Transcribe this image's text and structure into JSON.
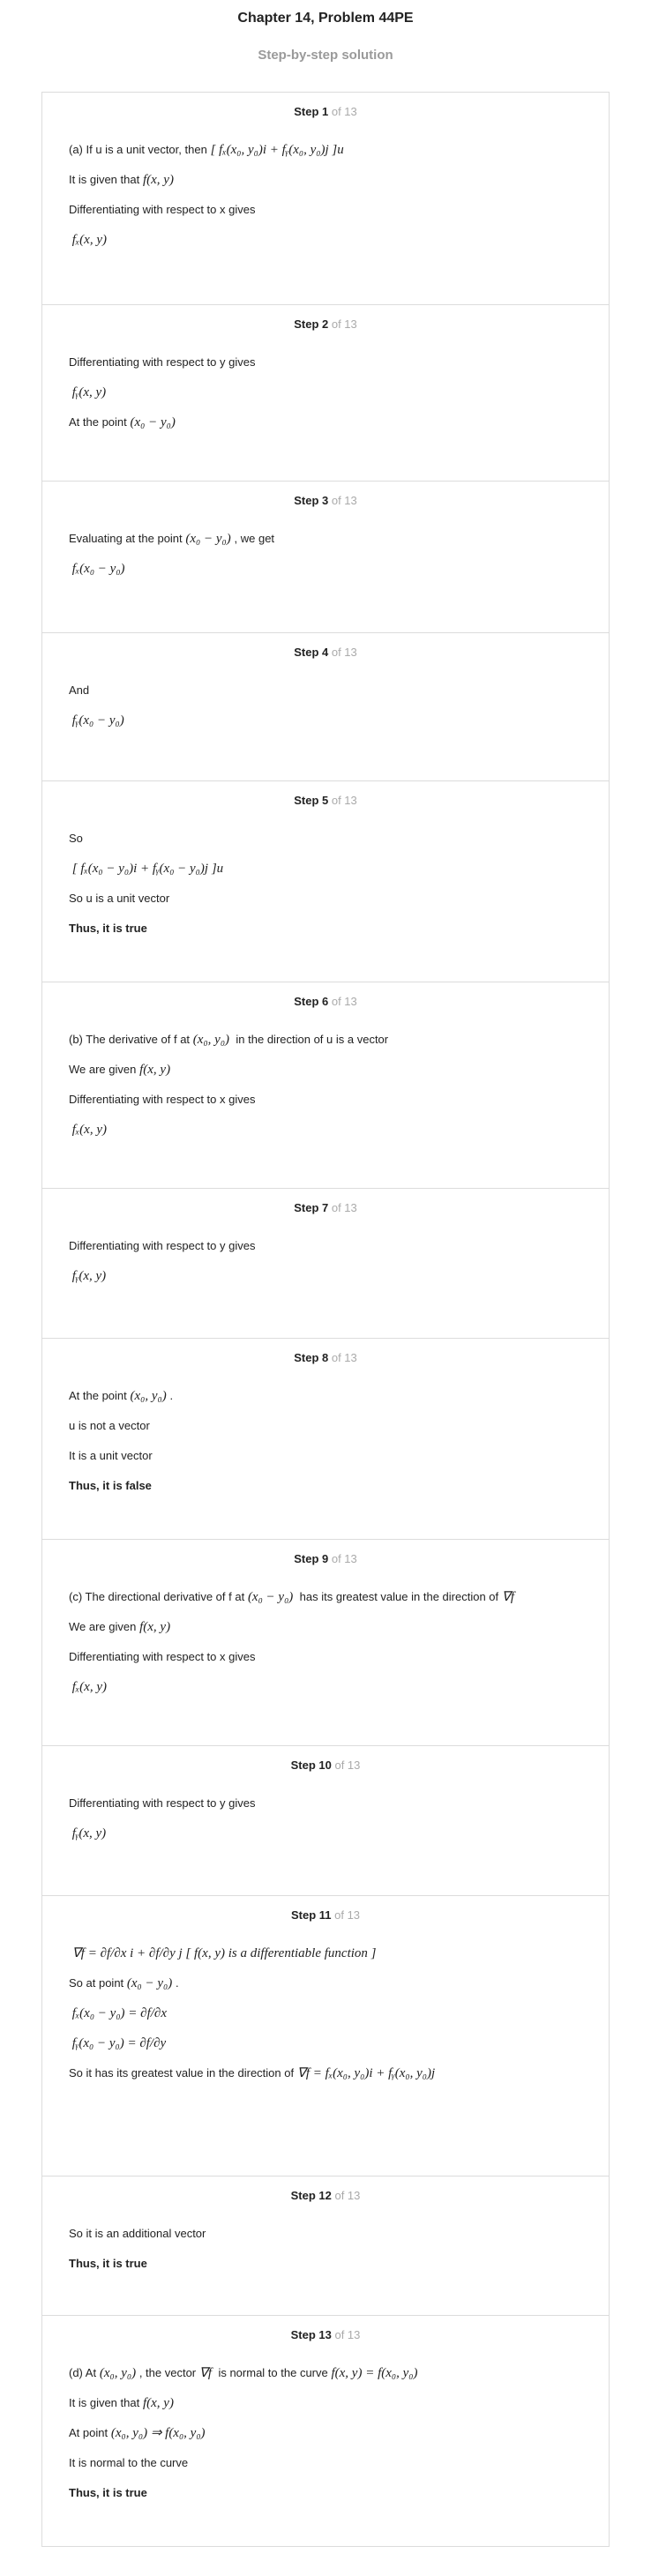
{
  "header": {
    "title": "Chapter 14, Problem 44PE",
    "subtitle": "Step-by-step solution"
  },
  "step_of": "of 13",
  "steps": [
    {
      "label": "Step 1",
      "lines": [
        {
          "t": "(a) If u is a unit vector, then",
          "m": "[ fₓ(x₀, y₀)i + fᵧ(x₀, y₀)j ]u"
        },
        {
          "t": "It is given that",
          "m": "f(x, y)"
        },
        {
          "t": "Differentiating with respect to x gives",
          "m": ""
        },
        {
          "t": "",
          "m": "fₓ(x, y)"
        }
      ]
    },
    {
      "label": "Step 2",
      "lines": [
        {
          "t": "Differentiating with respect to y gives",
          "m": ""
        },
        {
          "t": "",
          "m": "fᵧ(x, y)"
        },
        {
          "t": "At the point",
          "m": "(x₀ − y₀)"
        }
      ]
    },
    {
      "label": "Step 3",
      "lines": [
        {
          "t": "Evaluating at the point",
          "m": "(x₀ − y₀)",
          "t2": ", we get"
        },
        {
          "t": "",
          "m": "fₓ(x₀ − y₀)"
        }
      ]
    },
    {
      "label": "Step 4",
      "lines": [
        {
          "t": "And",
          "m": ""
        },
        {
          "t": "",
          "m": "fᵧ(x₀ − y₀)"
        }
      ]
    },
    {
      "label": "Step 5",
      "lines": [
        {
          "t": "So",
          "m": ""
        },
        {
          "t": "",
          "m": "[ fₓ(x₀ − y₀)i + fᵧ(x₀ − y₀)j ]u"
        },
        {
          "t": "So u is a unit vector",
          "m": ""
        },
        {
          "t": "Thus, it is true",
          "m": "",
          "bold": true
        }
      ]
    },
    {
      "label": "Step 6",
      "lines": [
        {
          "t": "(b) The derivative of f at",
          "m": "(x₀, y₀)",
          "t2": " in the direction of u is a vector"
        },
        {
          "t": "We are given",
          "m": "f(x, y)"
        },
        {
          "t": "Differentiating with respect to x gives",
          "m": ""
        },
        {
          "t": "",
          "m": "fₓ(x, y)"
        }
      ]
    },
    {
      "label": "Step 7",
      "lines": [
        {
          "t": "Differentiating with respect to y gives",
          "m": ""
        },
        {
          "t": "",
          "m": "fᵧ(x, y)"
        }
      ]
    },
    {
      "label": "Step 8",
      "lines": [
        {
          "t": "At the point",
          "m": "(x₀, y₀)",
          "t2": "."
        },
        {
          "t": "u is not a vector",
          "m": ""
        },
        {
          "t": "It is a unit vector",
          "m": ""
        },
        {
          "t": "Thus, it is false",
          "m": "",
          "bold": true
        }
      ]
    },
    {
      "label": "Step 9",
      "lines": [
        {
          "t": "(c) The directional derivative of f at",
          "m": "(x₀ − y₀)",
          "t2": " has its greatest value in the direction of",
          "m2": "∇f"
        },
        {
          "t": "We are given",
          "m": "f(x, y)"
        },
        {
          "t": "Differentiating with respect to x gives",
          "m": ""
        },
        {
          "t": "",
          "m": "fₓ(x, y)"
        }
      ]
    },
    {
      "label": "Step 10",
      "lines": [
        {
          "t": "Differentiating with respect to y gives",
          "m": ""
        },
        {
          "t": "",
          "m": "fᵧ(x, y)"
        }
      ]
    },
    {
      "label": "Step 11",
      "lines": [
        {
          "t": "",
          "m": "∇f = ∂f/∂x i + ∂f/∂y j      [ f(x, y) is a differentiable function ]"
        },
        {
          "t": "So at point",
          "m": "(x₀ − y₀)",
          "t2": "."
        },
        {
          "t": "",
          "m": "fₓ(x₀ − y₀) = ∂f/∂x"
        },
        {
          "t": "",
          "m": "fᵧ(x₀ − y₀) = ∂f/∂y"
        },
        {
          "t": "So it has its greatest value in the direction of",
          "m": "∇f = fₓ(x₀, y₀)i + fᵧ(x₀, y₀)j"
        }
      ]
    },
    {
      "label": "Step 12",
      "lines": [
        {
          "t": "So it is an additional vector",
          "m": ""
        },
        {
          "t": "Thus, it is true",
          "m": "",
          "bold": true
        }
      ]
    },
    {
      "label": "Step 13",
      "lines": [
        {
          "t": "(d) At",
          "m": "(x₀, y₀)",
          "t2": ", the vector",
          "m2": "∇f",
          "t3": " is normal to the curve",
          "m3": "f(x, y) = f(x₀, y₀)"
        },
        {
          "t": "It is given that",
          "m": "f(x, y)"
        },
        {
          "t": "At point",
          "m": "(x₀, y₀) ⇒ f(x₀, y₀)"
        },
        {
          "t": "It is normal to the curve",
          "m": ""
        },
        {
          "t": "Thus, it is true",
          "m": "",
          "bold": true
        }
      ]
    }
  ]
}
